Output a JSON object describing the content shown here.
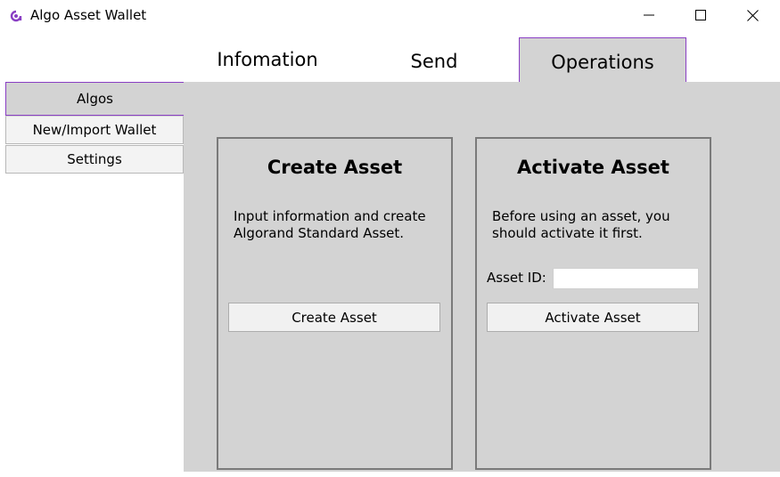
{
  "window": {
    "title": "Algo Asset Wallet",
    "icon": "algo-app-icon",
    "accent_color": "#8a3fc4"
  },
  "tabs": [
    {
      "label": "Infomation",
      "selected": false
    },
    {
      "label": "Send",
      "selected": false
    },
    {
      "label": "Operations",
      "selected": true
    }
  ],
  "nav": {
    "items": [
      {
        "label": "Algos",
        "selected": true
      },
      {
        "label": "New/Import Wallet",
        "selected": false
      },
      {
        "label": "Settings",
        "selected": false
      }
    ]
  },
  "create_panel": {
    "title": "Create Asset",
    "description": "Input information and create Algorand Standard Asset.",
    "button_label": "Create Asset"
  },
  "activate_panel": {
    "title": "Activate Asset",
    "description": "Before using an asset, you should activate it first.",
    "field_label": "Asset ID:",
    "field_value": "",
    "button_label": "Activate Asset"
  }
}
